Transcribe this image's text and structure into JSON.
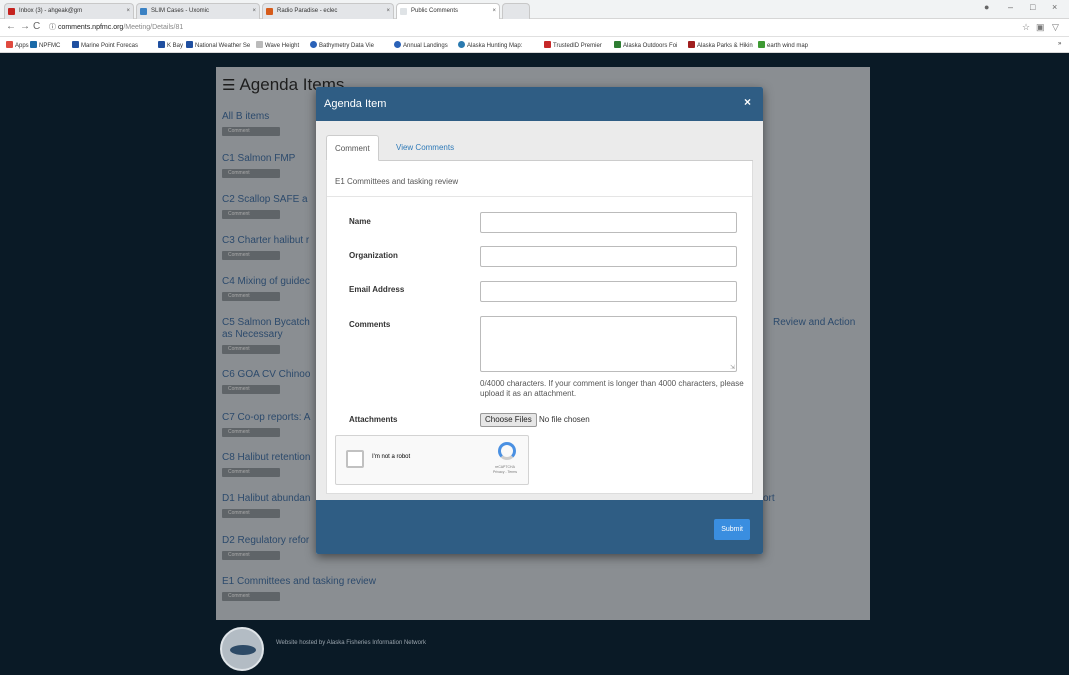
{
  "browser": {
    "tabs": [
      {
        "label": "Inbox (3) - ahgeak@gm",
        "fav": "#c5221f"
      },
      {
        "label": "SLIM Cases - Uxomic",
        "fav": "#3b82c4"
      },
      {
        "label": "Radio Paradise - eclec",
        "fav": "#d65b1a"
      },
      {
        "label": "Public Comments",
        "fav": "#dfe3e6"
      }
    ],
    "url_host": "comments.npfmc.org",
    "url_path": "/Meeting/Details/81",
    "bookmarks": [
      {
        "label": "Apps",
        "color": "#e04a3f"
      },
      {
        "label": "NPFMC",
        "color": "#1b6aa8"
      },
      {
        "label": "Marine Point Forecas",
        "color": "#1f4fa0"
      },
      {
        "label": "K Bay",
        "color": "#1f4fa0"
      },
      {
        "label": "National Weather Se",
        "color": "#1f4fa0"
      },
      {
        "label": "Wave Height",
        "color": "#bbbbbb"
      },
      {
        "label": "Bathymetry Data Vie",
        "color": "#2a62b8"
      },
      {
        "label": "Annual Landings",
        "color": "#2a62b8"
      },
      {
        "label": "Alaska Hunting Map:",
        "color": "#2a7ab0"
      },
      {
        "label": "TrustedID Premier",
        "color": "#c62828"
      },
      {
        "label": "Alaska Outdoors Foi",
        "color": "#2e7d32"
      },
      {
        "label": "Alaska Parks & Hikin",
        "color": "#a01e1e"
      },
      {
        "label": "earth wind map",
        "color": "#3e9a33"
      }
    ]
  },
  "page": {
    "heading": "Agenda Items",
    "comment_btn": "Comment",
    "items": [
      "All B items",
      "C1 Salmon FMP",
      "C2 Scallop SAFE a",
      "C3 Charter halibut r",
      "C4 Mixing of guidec",
      "C5 Salmon Bycatch",
      "C6 GOA CV Chinoo",
      "C7 Co-op reports: A",
      "C8 Halibut retention",
      "D1 Halibut abundan",
      "D2 Regulatory refor",
      "E1 Committees and tasking review"
    ],
    "c5_line2": "as Necessary",
    "c5_right": "Review and Action",
    "d1_right": "ort",
    "footer": "Website hosted by Alaska Fisheries Information Network"
  },
  "modal": {
    "title": "Agenda Item",
    "close": "×",
    "tab_comment": "Comment",
    "tab_view": "View Comments",
    "item_title": "E1 Committees and tasking review",
    "label_name": "Name",
    "label_org": "Organization",
    "label_email": "Email Address",
    "label_comments": "Comments",
    "help": "0/4000 characters. If your comment is longer than 4000 characters, please upload it as an attachment.",
    "label_attach": "Attachments",
    "file_btn": "Choose Files",
    "file_status": "No file chosen",
    "captcha_text": "I'm not a robot",
    "captcha_brand": "reCAPTCHA",
    "captcha_links": "Privacy - Terms",
    "submit": "Submit"
  }
}
